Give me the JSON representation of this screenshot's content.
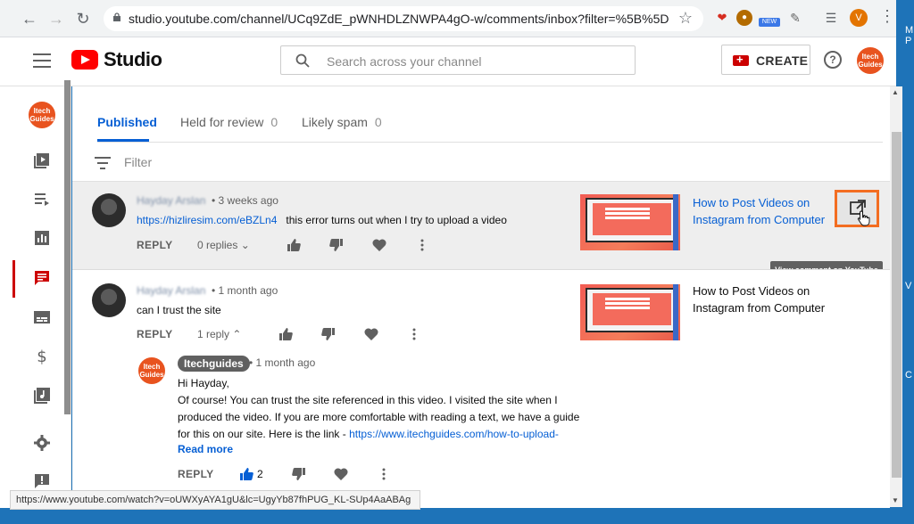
{
  "browser": {
    "url": "studio.youtube.com/channel/UCq9ZdE_pWNHDLZNWPA4gO-w/comments/inbox?filter=%5B%5D",
    "profile_initial": "V",
    "ext_new_badge": "NEW",
    "status_url": "https://www.youtube.com/watch?v=oUWXyAYA1gU&lc=UgyYb87fhPUG_KL-SUp4AaABAg"
  },
  "desktop_edge_text": [
    "M",
    "P",
    "V",
    "C"
  ],
  "header": {
    "brand": "Studio",
    "search_placeholder": "Search across your channel",
    "create_label": "CREATE",
    "help_glyph": "?",
    "channel_avatar_line1": "Itech",
    "channel_avatar_line2": "Guides"
  },
  "tabs": [
    {
      "label": "Published",
      "count": ""
    },
    {
      "label": "Held for review",
      "count": "0"
    },
    {
      "label": "Likely spam",
      "count": "0"
    }
  ],
  "filter": {
    "label": "Filter"
  },
  "comments": [
    {
      "author": "Hayday Arslan",
      "time": "3 weeks ago",
      "link": "https://hizliresim.com/eBZLn4",
      "text": "this error turns out when I try to upload a video",
      "reply_label": "REPLY",
      "replies": "0 replies",
      "video_title": "How to Post Videos on Instagram from Computer",
      "tooltip": "View comment on YouTube"
    },
    {
      "author": "Hayday Arslan",
      "time": "1 month ago",
      "text": "can I trust the site",
      "reply_label": "REPLY",
      "replies": "1 reply",
      "video_title": "How to Post Videos on Instagram from Computer"
    }
  ],
  "reply": {
    "author": "Itechguides",
    "time": "1 month ago",
    "lines": [
      "Hi Hayday,",
      "Of course! You can trust the site referenced in this video. I visited the site when I",
      "produced the video. If you are more comfortable with reading a text, we have a guide",
      "for this on our site. Here is the link - "
    ],
    "link": "https://www.itechguides.com/how-to-upload-",
    "read_more": "Read more",
    "reply_label": "REPLY",
    "likes": "2"
  },
  "colors": {
    "accent": "#065fd4",
    "youtube_red": "#ff0000",
    "highlight": "#f36d21",
    "avatar": "#e8531f"
  }
}
